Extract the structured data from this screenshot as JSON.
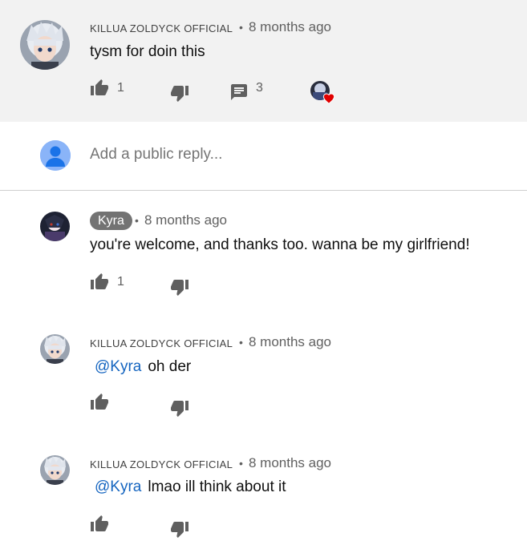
{
  "top_comment": {
    "author": "KILLUA ZOLDYCK OFFICIAL",
    "separator": "•",
    "time": "8 months ago",
    "text": "tysm for doin this",
    "likes": "1",
    "replies": "3",
    "icons": {
      "like": "thumbs-up-icon",
      "dislike": "thumbs-down-icon",
      "reply": "comment-icon",
      "hearted": "creator-heart-icon"
    }
  },
  "reply_box": {
    "placeholder": "Add a public reply..."
  },
  "replies": [
    {
      "author": "Kyra",
      "separator": "•",
      "time": "8 months ago",
      "mention": "",
      "text": "you're welcome, and thanks too. wanna be my girlfriend!",
      "likes": "1"
    },
    {
      "author": "KILLUA ZOLDYCK OFFICIAL",
      "separator": "•",
      "time": "8 months ago",
      "mention": "@Kyra",
      "text": "oh der",
      "likes": ""
    },
    {
      "author": "KILLUA ZOLDYCK OFFICIAL",
      "separator": "•",
      "time": "8 months ago",
      "mention": "@Kyra",
      "text": "lmao ill think about it",
      "likes": ""
    }
  ],
  "colors": {
    "highlight_bg": "#f2f2f2",
    "mention": "#1565c0",
    "heart": "#e00000",
    "icon": "#5f5f5f",
    "chip": "#737373"
  }
}
